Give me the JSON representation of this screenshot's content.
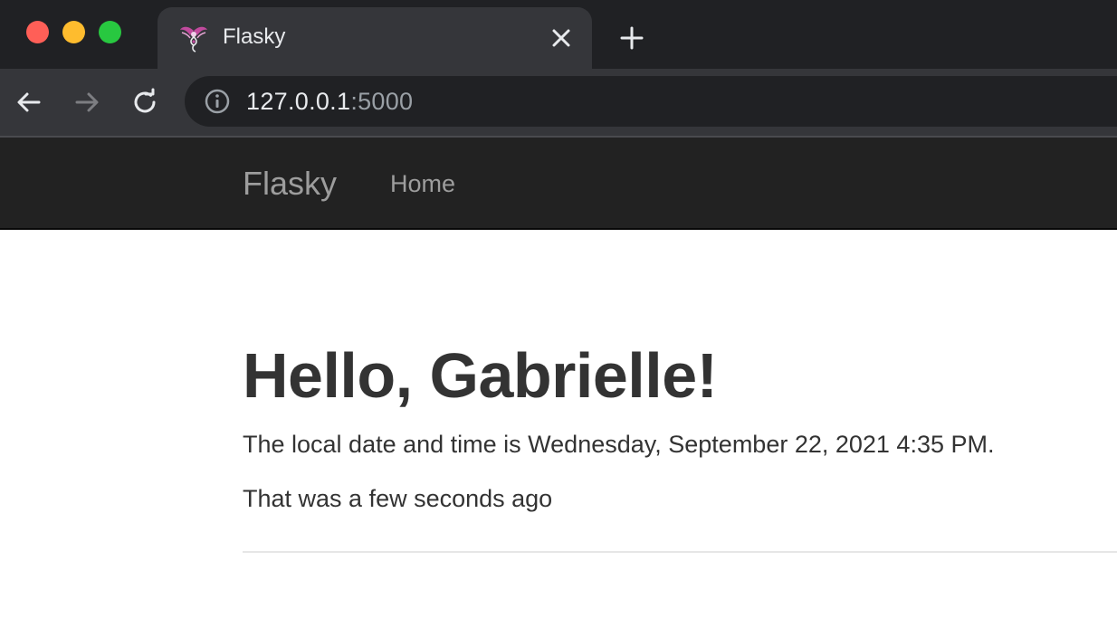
{
  "window": {
    "buttons": [
      "close",
      "minimize",
      "maximize"
    ]
  },
  "tab": {
    "title": "Flasky",
    "favicon": "phoenix-favicon",
    "close_icon": "close-icon"
  },
  "new_tab_icon": "plus-icon",
  "toolbar": {
    "back_icon": "arrow-left-icon",
    "forward_icon": "arrow-right-icon",
    "reload_icon": "reload-icon",
    "info_icon": "info-icon",
    "url_host": "127.0.0.1",
    "url_port": ":5000"
  },
  "navbar": {
    "brand": "Flasky",
    "links": [
      {
        "label": "Home"
      }
    ]
  },
  "main": {
    "greeting": "Hello, Gabrielle!",
    "local_time": "The local date and time is Wednesday, September 22, 2021 4:35 PM.",
    "relative_time": "That was a few seconds ago"
  },
  "colors": {
    "titlebar": "#202124",
    "tab_active": "#35363a",
    "navbar_bg": "#222222",
    "navbar_text": "#9d9d9d",
    "body_text": "#333333",
    "traffic_red": "#ff5f57",
    "traffic_yellow": "#febc2e",
    "traffic_green": "#28c840"
  }
}
